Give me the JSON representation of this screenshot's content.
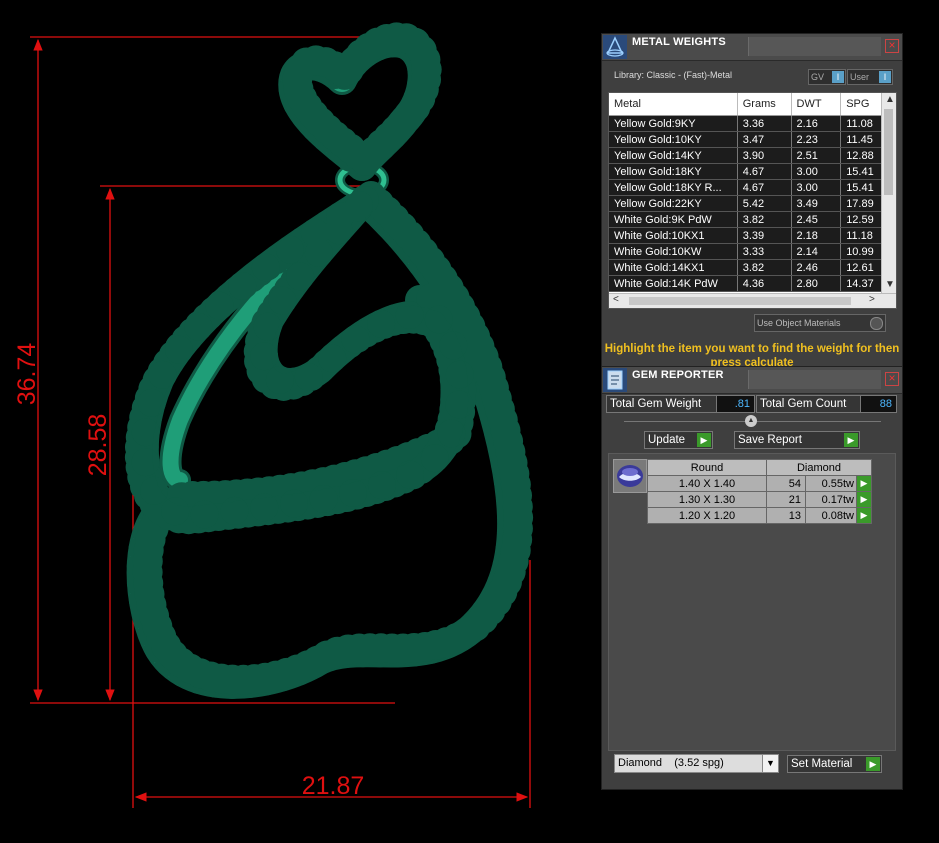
{
  "viewport": {
    "dimensions": {
      "height_total": "36.74",
      "height_inner": "28.58",
      "width": "21.87"
    }
  },
  "metal_weights": {
    "title": "METAL WEIGHTS",
    "library": "Library: Classic - (Fast)-Metal",
    "toggle_gv": "GV",
    "toggle_user": "User",
    "columns": [
      "Metal",
      "Grams",
      "DWT",
      "SPG"
    ],
    "rows": [
      [
        "Yellow Gold:9KY",
        "3.36",
        "2.16",
        "11.08"
      ],
      [
        "Yellow Gold:10KY",
        "3.47",
        "2.23",
        "11.45"
      ],
      [
        "Yellow Gold:14KY",
        "3.90",
        "2.51",
        "12.88"
      ],
      [
        "Yellow Gold:18KY",
        "4.67",
        "3.00",
        "15.41"
      ],
      [
        "Yellow Gold:18KY R...",
        "4.67",
        "3.00",
        "15.41"
      ],
      [
        "Yellow Gold:22KY",
        "5.42",
        "3.49",
        "17.89"
      ],
      [
        "White Gold:9K PdW",
        "3.82",
        "2.45",
        "12.59"
      ],
      [
        "White Gold:10KX1",
        "3.39",
        "2.18",
        "11.18"
      ],
      [
        "White Gold:10KW",
        "3.33",
        "2.14",
        "10.99"
      ],
      [
        "White Gold:14KX1",
        "3.82",
        "2.46",
        "12.61"
      ],
      [
        "White Gold:14K PdW",
        "4.36",
        "2.80",
        "14.37"
      ]
    ],
    "use_object_materials": "Use Object Materials",
    "hint": "Highlight the item you want to find the weight for then press calculate"
  },
  "gem_reporter": {
    "title": "GEM REPORTER",
    "total_weight_label": "Total Gem Weight",
    "total_weight_value": ".81",
    "total_count_label": "Total Gem Count",
    "total_count_value": "88",
    "update_label": "Update",
    "save_report_label": "Save Report",
    "table_headers": [
      "Round",
      "Diamond"
    ],
    "gems": [
      {
        "size": "1.40 X 1.40",
        "count": "54",
        "weight": "0.55tw"
      },
      {
        "size": "1.30 X 1.30",
        "count": "21",
        "weight": "0.17tw"
      },
      {
        "size": "1.20 X 1.20",
        "count": "13",
        "weight": "0.08tw"
      }
    ],
    "material_select": "Diamond    (3.52 spg)",
    "set_material_label": "Set Material"
  },
  "colors": {
    "dimension": "#e01010",
    "metal": "#1f9e78",
    "gem": "#8ab8ff",
    "prong": "#6a2ab0",
    "hint": "#f0c020",
    "go_button": "#3a9a2a"
  }
}
